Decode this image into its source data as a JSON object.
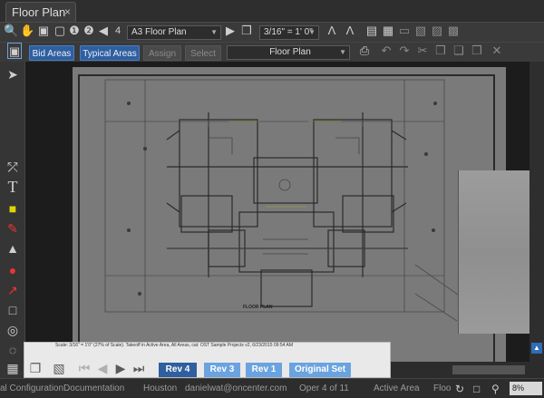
{
  "tab": {
    "title": "Floor Plan",
    "close": "×"
  },
  "toolbar1": {
    "page_number": "4",
    "page_name": "A3 Floor Plan",
    "scale": "3/16\" = 1' 0\""
  },
  "toolbar2": {
    "bid_areas": "Bid Areas",
    "typical_areas": "Typical Areas",
    "assign": "Assign",
    "select": "Select",
    "layer": "Floor Plan"
  },
  "drawing": {
    "title": "FLOOR PLAN"
  },
  "revisions": {
    "note": "Scale: 3/16\" = 1'0\" (27% of Scale). Takeoff in Active Area, All Areas, cat: OST Sample Projects v2, 6/23/2015 09:54 AM",
    "buttons": [
      "Rev 4",
      "Rev 3",
      "Rev 1",
      "Original Set"
    ],
    "active": "Rev 4"
  },
  "status": {
    "item1": "al ConfigurationDocumentation",
    "item2": "Houston",
    "item3": "danielwat@oncenter.com",
    "item4": "Oper 4 of 11",
    "item5": "Active Area",
    "item6": "Floo",
    "zoom": "8%"
  }
}
